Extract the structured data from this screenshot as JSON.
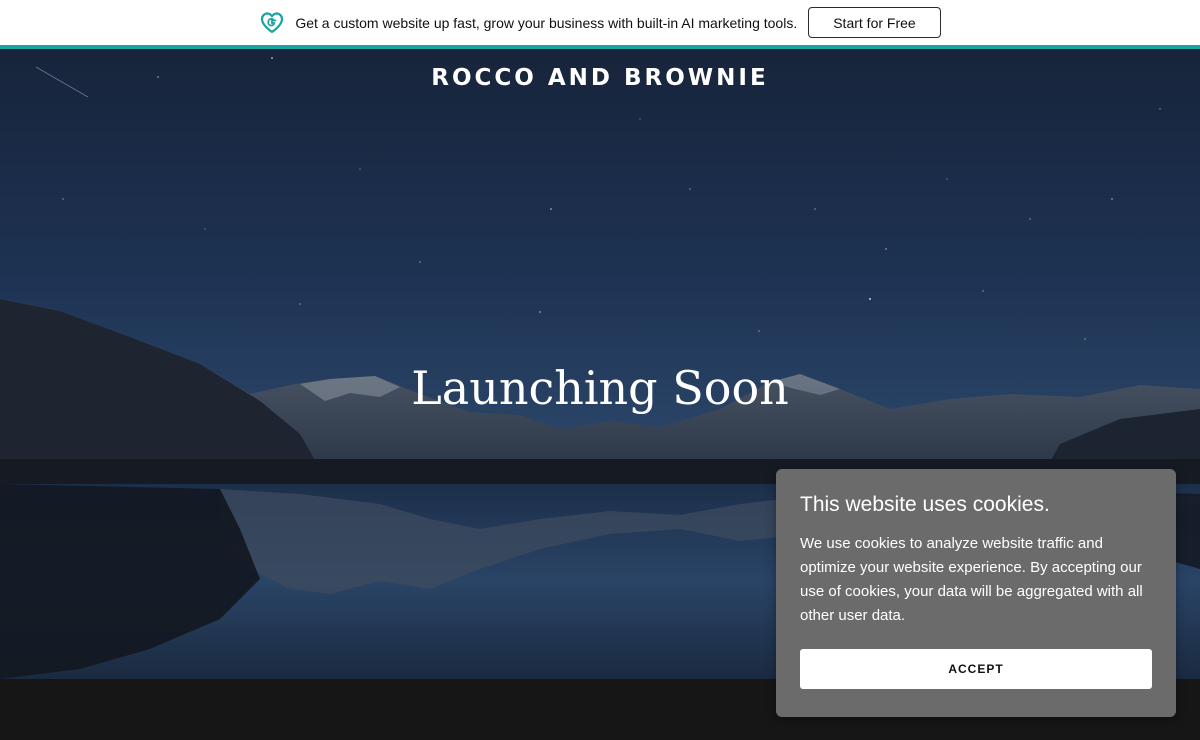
{
  "promo": {
    "logo_icon": "godaddy-heart-g-icon",
    "message": "Get a custom website up fast, grow your business with built-in AI marketing tools.",
    "cta_label": "Start for Free",
    "accent_color": "#1aa3a3"
  },
  "hero": {
    "brand_name": "ROCCO AND BROWNIE",
    "headline": "Launching Soon"
  },
  "cookie_banner": {
    "title": "This website uses cookies.",
    "body": "We use cookies to analyze website traffic and optimize your website experience. By accepting our use of cookies, your data will be aggregated with all other user data.",
    "accept_label": "ACCEPT",
    "background_color": "#6b6b6b"
  }
}
